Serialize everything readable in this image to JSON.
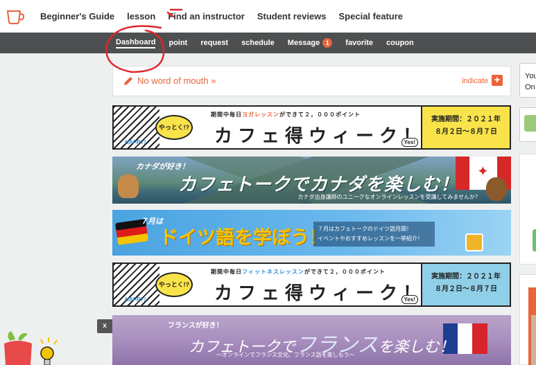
{
  "topnav": {
    "items": [
      "Beginner's Guide",
      "lesson",
      "Find an instructor",
      "Student reviews",
      "Special feature"
    ]
  },
  "subnav": {
    "items": [
      "Dashboard",
      "point",
      "request",
      "schedule",
      "Message",
      "favorite",
      "coupon"
    ],
    "message_badge": "1"
  },
  "word_of_mouth": {
    "label": "No word of mouth »",
    "indicate": "indicate",
    "plus": "+"
  },
  "banners": {
    "cafe_week_1": {
      "top_a": "期間中毎日",
      "top_hl": "ヨガレッスン",
      "top_b": "ができて２，０００ポイント",
      "bubble": "やっとく!?",
      "happy": "HAPPY!",
      "main": "カフェ得ウィーク！",
      "period_1": "実施期間：２０２１年",
      "period_2": "８月２日〜８月７日",
      "yes": "Yes!"
    },
    "canada": {
      "t1": "カナダが好き！",
      "t2": "カフェトークでカナダを楽しむ！",
      "t3": "カナダ出身講師のユニークなオンラインレッスンを受講してみませんか？"
    },
    "german": {
      "t1": "７月は",
      "t2": "ドイツ語を学ぼう！",
      "t3_1": "７月はカフェトークのドイツ語月間！",
      "t3_2": "イベントやおすすめレッスンを一挙紹介！"
    },
    "cafe_week_2": {
      "top_a": "期間中毎日",
      "top_hl": "フィットネスレッスン",
      "top_b": "ができて２，０００ポイント",
      "bubble": "やっとく!?",
      "happy": "HAPPY!",
      "main": "カフェ得ウィーク！",
      "period_1": "実施期間：２０２１年",
      "period_2": "８月２日〜８月７日",
      "yes": "Yes!"
    },
    "france": {
      "t1": "フランスが好き！",
      "t2_a": "カフェトークで",
      "t2_big": "フランス",
      "t2_b": "を楽しむ！",
      "t3": "〜オンラインでフランス文化、フランス語を楽しもう〜"
    }
  },
  "close_button": "x",
  "sidebar": {
    "line1": "You",
    "line2": "On"
  },
  "colors": {
    "accent": "#e8643c",
    "subnav_bg": "#4d4f50",
    "annotation": "#e0262a"
  }
}
